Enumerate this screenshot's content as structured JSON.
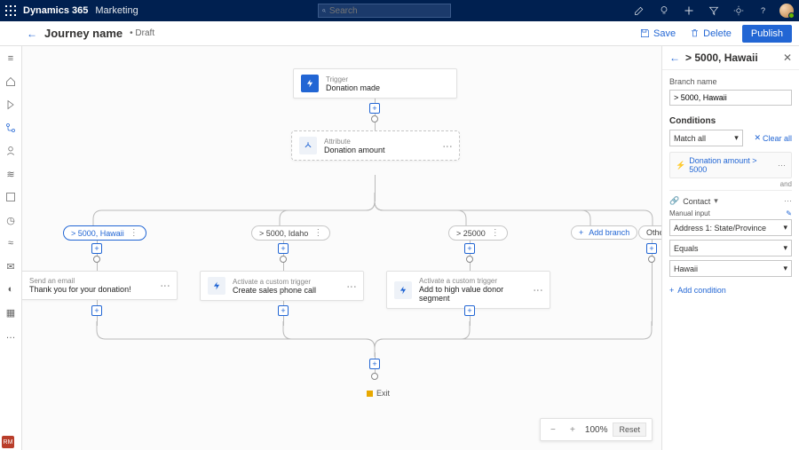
{
  "topbar": {
    "product": "Dynamics 365",
    "module": "Marketing",
    "search_placeholder": "Search"
  },
  "header": {
    "title": "Journey name",
    "status": "• Draft",
    "save_label": "Save",
    "delete_label": "Delete",
    "publish_label": "Publish"
  },
  "journey": {
    "trigger": {
      "label": "Trigger",
      "value": "Donation made"
    },
    "attribute": {
      "label": "Attribute",
      "value": "Donation amount"
    },
    "branches": [
      {
        "label": "> 5000, Hawaii",
        "selected": true
      },
      {
        "label": "> 5000, Idaho",
        "selected": false
      },
      {
        "label": "> 25000",
        "selected": false
      }
    ],
    "add_branch_label": "Add branch",
    "other_label": "Other",
    "actions": {
      "send": {
        "label": "Send an email",
        "value": "Thank you for your donation!"
      },
      "act1": {
        "label": "Activate a custom trigger",
        "value": "Create sales phone call"
      },
      "act2": {
        "label": "Activate a custom trigger",
        "value": "Add to high value donor segment"
      }
    },
    "exit_label": "Exit"
  },
  "zoom": {
    "level": "100%",
    "reset": "Reset"
  },
  "panel": {
    "title": "> 5000, Hawaii",
    "branch_name_label": "Branch name",
    "branch_name_value": "> 5000, Hawaii",
    "conditions_label": "Conditions",
    "match_mode": "Match all",
    "clear_all_label": "Clear all",
    "condition_summary": "Donation amount > 5000",
    "and_label": "and",
    "contact_group_label": "Contact",
    "manual_input_label": "Manual input",
    "field": "Address 1: State/Province",
    "operator": "Equals",
    "value": "Hawaii",
    "add_condition_label": "Add condition"
  },
  "bottom_badge": "RM"
}
